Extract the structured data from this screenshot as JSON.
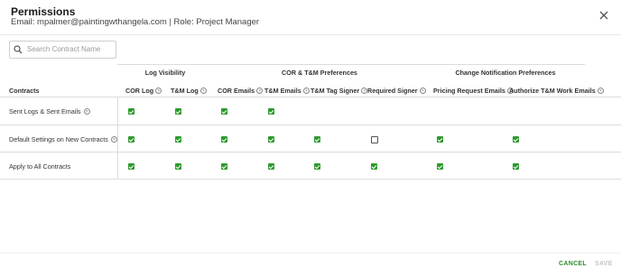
{
  "dialog": {
    "title": "Permissions",
    "subtitle": "Email: mpalmer@paintingwthangela.com | Role: Project Manager"
  },
  "search": {
    "placeholder": "Search Contract Name",
    "value": ""
  },
  "groups": [
    {
      "label": "Log Visibility"
    },
    {
      "label": "COR & T&M Preferences"
    },
    {
      "label": "Change Notification Preferences"
    }
  ],
  "columns": {
    "first": "Contracts",
    "items": [
      {
        "label": "COR Log"
      },
      {
        "label": "T&M Log"
      },
      {
        "label": "COR Emails"
      },
      {
        "label": "T&M Emails"
      },
      {
        "label": "T&M Tag Signer"
      },
      {
        "label": "Required Signer"
      },
      {
        "label": "Pricing Request Emails"
      },
      {
        "label": "Authorize T&M Work Emails"
      }
    ]
  },
  "rows": [
    {
      "label": "Sent Logs & Sent Emails",
      "info": true,
      "checks": [
        true,
        true,
        true,
        true,
        null,
        null,
        null,
        null
      ]
    },
    {
      "label": "Default Settings on New Contracts",
      "info": true,
      "checks": [
        true,
        true,
        true,
        true,
        true,
        false,
        true,
        true
      ]
    },
    {
      "label": "Apply to All Contracts",
      "info": false,
      "checks": [
        true,
        true,
        true,
        true,
        true,
        true,
        true,
        true
      ]
    }
  ],
  "footer": {
    "cancel_label": "CANCEL",
    "save_label": "SAVE"
  },
  "colors": {
    "accent": "#2e9a2e",
    "cancel": "#2e8b2e",
    "save_disabled": "#c4c4c4"
  }
}
